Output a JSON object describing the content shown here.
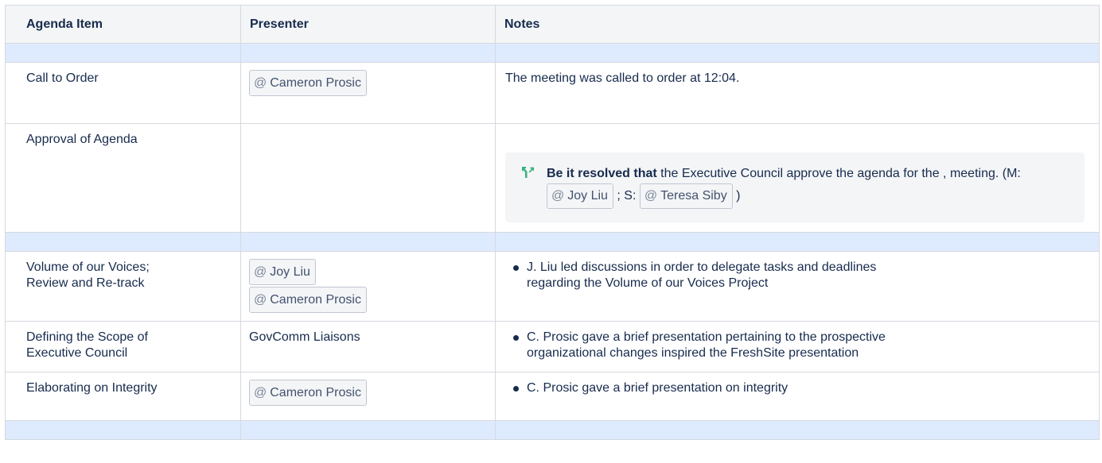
{
  "headers": {
    "col1": "Agenda Item",
    "col2": "Presenter",
    "col3": "Notes"
  },
  "rows": {
    "call_to_order": {
      "item": "Call to Order",
      "presenter": "Cameron Prosic",
      "note": "The meeting was called to order at 12:04."
    },
    "approval": {
      "item": "Approval of Agenda",
      "resolution": {
        "lead": "Be it resolved that",
        "text1": " the Executive Council approve the agenda for the , meeting. (M: ",
        "mover": "Joy Liu",
        "text2": " ; S: ",
        "seconder": "Teresa Siby",
        "text3": " )"
      }
    },
    "voices": {
      "item_line1": "Volume of our Voices;",
      "item_line2": "Review and Re-track",
      "presenter1": "Joy Liu",
      "presenter2": "Cameron Prosic",
      "note_line1": "J. Liu led discussions in order to delegate tasks and deadlines",
      "note_line2": "regarding the Volume of our Voices Project"
    },
    "scope": {
      "item_line1": "Defining the Scope of",
      "item_line2": "Executive Council",
      "presenter": "GovComm Liaisons",
      "note_line1": "C. Prosic gave a brief presentation pertaining to the prospective",
      "note_line2": "organizational changes inspired the FreshSite presentation"
    },
    "integrity": {
      "item": "Elaborating on Integrity",
      "presenter": "Cameron Prosic",
      "note": "C. Prosic gave a brief presentation on integrity"
    }
  },
  "mention_symbol": "@",
  "colors": {
    "header_bg": "#f4f5f7",
    "spacer_bg": "#deebff",
    "border": "#d5d9df",
    "text": "#172b4d",
    "resolve_icon": "#36b37e"
  },
  "icons": {
    "resolution": "decision-icon"
  }
}
